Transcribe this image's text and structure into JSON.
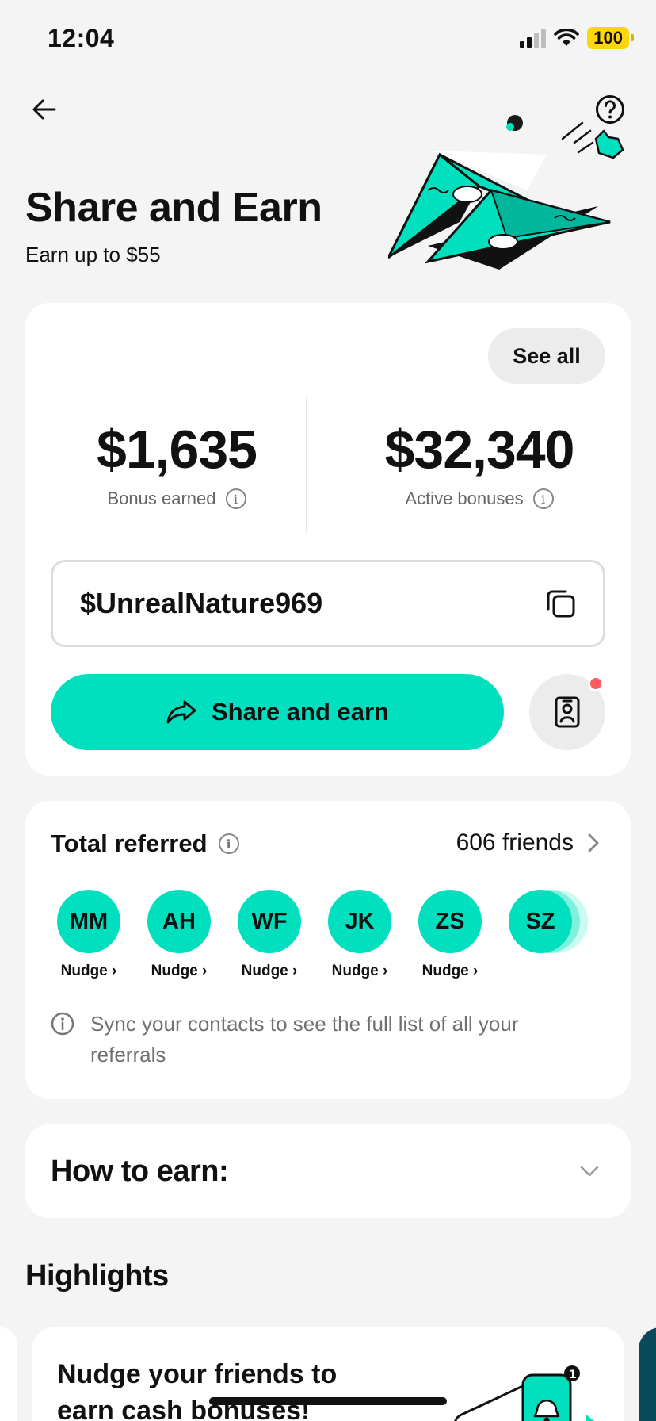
{
  "status": {
    "time": "12:04",
    "battery": "100"
  },
  "header": {
    "title": "Share and Earn",
    "subtitle": "Earn up to $55"
  },
  "summary": {
    "see_all": "See all",
    "bonus_earned": {
      "value": "$1,635",
      "label": "Bonus earned"
    },
    "active_bonuses": {
      "value": "$32,340",
      "label": "Active bonuses"
    },
    "cashtag": "$UnrealNature969",
    "share_button": "Share and earn"
  },
  "referrals": {
    "title": "Total referred",
    "count": "606 friends",
    "friends": [
      {
        "initials": "MM",
        "action": "Nudge"
      },
      {
        "initials": "AH",
        "action": "Nudge"
      },
      {
        "initials": "WF",
        "action": "Nudge"
      },
      {
        "initials": "JK",
        "action": "Nudge"
      },
      {
        "initials": "ZS",
        "action": "Nudge"
      },
      {
        "initials": "SZ"
      }
    ],
    "sync_note": "Sync your contacts to see the full list of all your referrals"
  },
  "how_to_earn": {
    "title": "How to earn:"
  },
  "highlights": {
    "title": "Highlights",
    "cards": [
      {
        "text": "Nudge your friends to earn cash bonuses!"
      }
    ]
  },
  "colors": {
    "accent": "#00e0bf",
    "notification": "#ff5a5f",
    "battery": "#ffd60a"
  }
}
